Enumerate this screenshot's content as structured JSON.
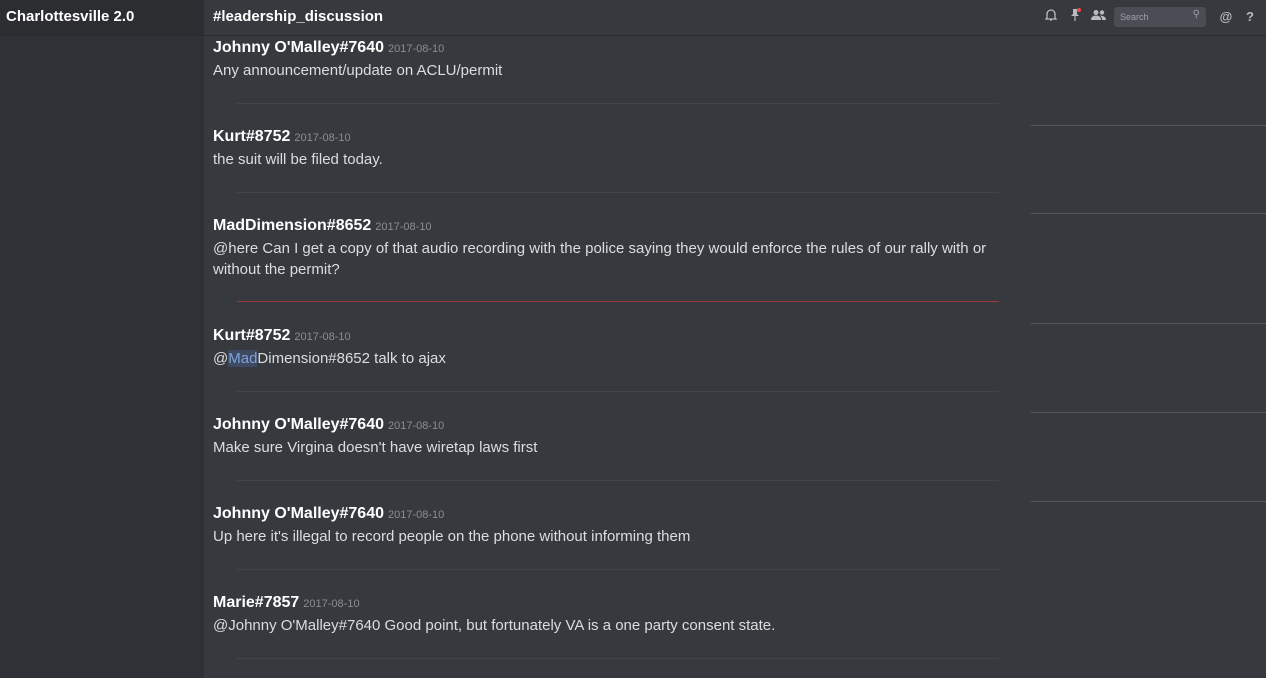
{
  "server": {
    "name": "Charlottesville 2.0"
  },
  "channel": {
    "name": "#leadership_discussion"
  },
  "toolbar": {
    "icons": [
      "bell-icon",
      "pin-icon",
      "members-icon",
      "mention-icon",
      "help-icon"
    ],
    "search_placeholder": "Search",
    "mention_glyph": "@",
    "help_glyph": "?"
  },
  "colors": {
    "background": "#36393e",
    "sidebar": "#2f3136",
    "new_messages_divider": "#9b3a3d"
  },
  "messages": [
    {
      "author": "Johnny O'Malley#7640",
      "timestamp": "2017-08-10",
      "text": "Any announcement/update on ACLU/permit"
    },
    {
      "author": "Kurt#8752",
      "timestamp": "2017-08-10",
      "text": "the suit will be filed today."
    },
    {
      "author": "MadDimension#8652",
      "timestamp": "2017-08-10",
      "text": "@here Can I get a copy of that audio recording with the police saying they would enforce the rules of our rally with or without the permit?"
    },
    {
      "author": "Kurt#8752",
      "timestamp": "2017-08-10",
      "text_parts": [
        "@",
        "Mad",
        "Dimension#8652 talk to ajax"
      ]
    },
    {
      "author": "Johnny O'Malley#7640",
      "timestamp": "2017-08-10",
      "text": "Make sure Virgina doesn't have wiretap laws first"
    },
    {
      "author": "Johnny O'Malley#7640",
      "timestamp": "2017-08-10",
      "text": "Up here it's illegal to record people on the phone without informing them"
    },
    {
      "author": "Marie#7857",
      "timestamp": "2017-08-10",
      "text": "@Johnny O'Malley#7640 Good point, but fortunately VA is a one party consent state."
    }
  ]
}
